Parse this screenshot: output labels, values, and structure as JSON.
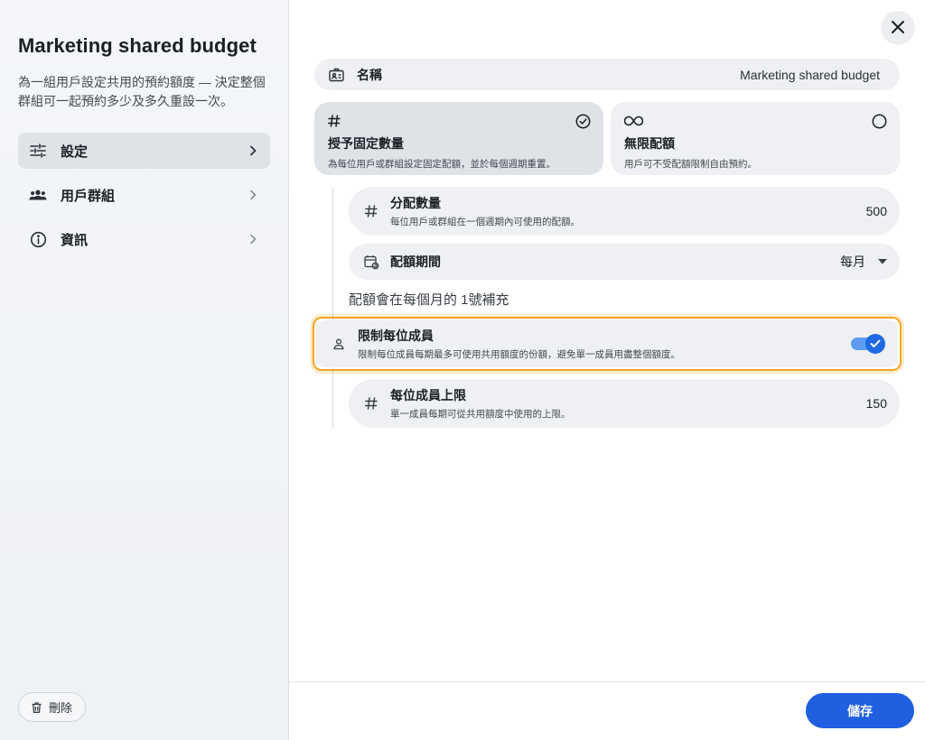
{
  "sidebar": {
    "title": "Marketing shared budget",
    "description": "為一組用戶設定共用的預約額度 — 決定整個群組可一起預約多少及多久重設一次。",
    "items": [
      {
        "label": "設定",
        "icon": "sliders-icon",
        "active": true
      },
      {
        "label": "用戶群組",
        "icon": "users-icon",
        "active": false
      },
      {
        "label": "資訊",
        "icon": "info-icon",
        "active": false
      }
    ],
    "delete_label": "刪除"
  },
  "main": {
    "name": {
      "label": "名稱",
      "value": "Marketing shared budget"
    },
    "options": [
      {
        "title": "授予固定數量",
        "subtitle": "為每位用戶或群組設定固定配額，並於每個週期重置。",
        "icon": "hash-icon",
        "selected": true
      },
      {
        "title": "無限配額",
        "subtitle": "用戶可不受配額限制自由預約。",
        "icon": "infinity-icon",
        "selected": false
      }
    ],
    "allocation": {
      "label": "分配數量",
      "subtitle": "每位用戶或群組在一個週期內可使用的配額。",
      "value": "500"
    },
    "period": {
      "label": "配額期間",
      "value": "每月"
    },
    "note": "配額會在每個月的 1號補充",
    "limit_member": {
      "label": "限制每位成員",
      "subtitle": "限制每位成員每期最多可使用共用額度的份額，避免單一成員用盡整個額度。",
      "enabled": true
    },
    "member_cap": {
      "label": "每位成員上限",
      "subtitle": "單一成員每期可從共用額度中使用的上限。",
      "value": "150"
    },
    "save_label": "儲存"
  },
  "colors": {
    "accent": "#1f5fe0",
    "highlight": "#f5a524",
    "toggle_on": "#5e9bf0"
  }
}
